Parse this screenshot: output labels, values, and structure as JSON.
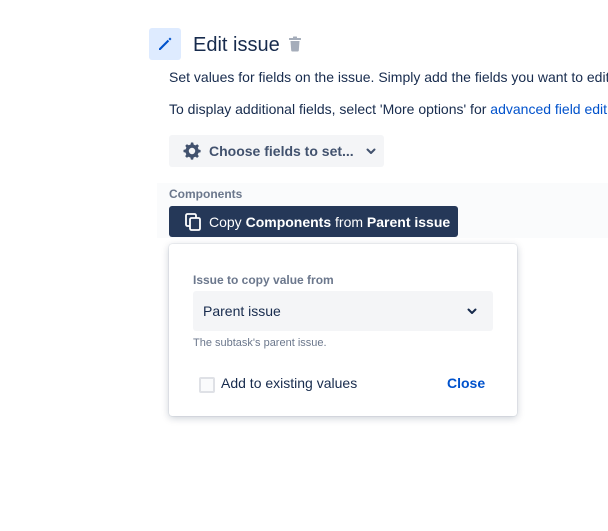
{
  "header": {
    "title": "Edit issue",
    "icon": "pencil-icon",
    "delete_icon": "trash-icon"
  },
  "description": {
    "line1": "Set values for fields on the issue. Simply add the fields you want to edit",
    "line2_prefix": "To display additional fields, select 'More options' for ",
    "line2_link": "advanced field edit"
  },
  "choose_fields": {
    "label": "Choose fields to set...",
    "icon": "gear-icon"
  },
  "components": {
    "label": "Components",
    "copy_prefix": "Copy ",
    "copy_field": "Components",
    "copy_middle": " from ",
    "copy_source": "Parent issue"
  },
  "popup": {
    "label": "Issue to copy value from",
    "selected": "Parent issue",
    "helper": "The subtask's parent issue.",
    "checkbox_label": "Add to existing values",
    "checkbox_checked": false,
    "close_label": "Close"
  },
  "colors": {
    "accent": "#0052cc",
    "dark_button": "#253858",
    "icon_bg": "#deebff"
  }
}
